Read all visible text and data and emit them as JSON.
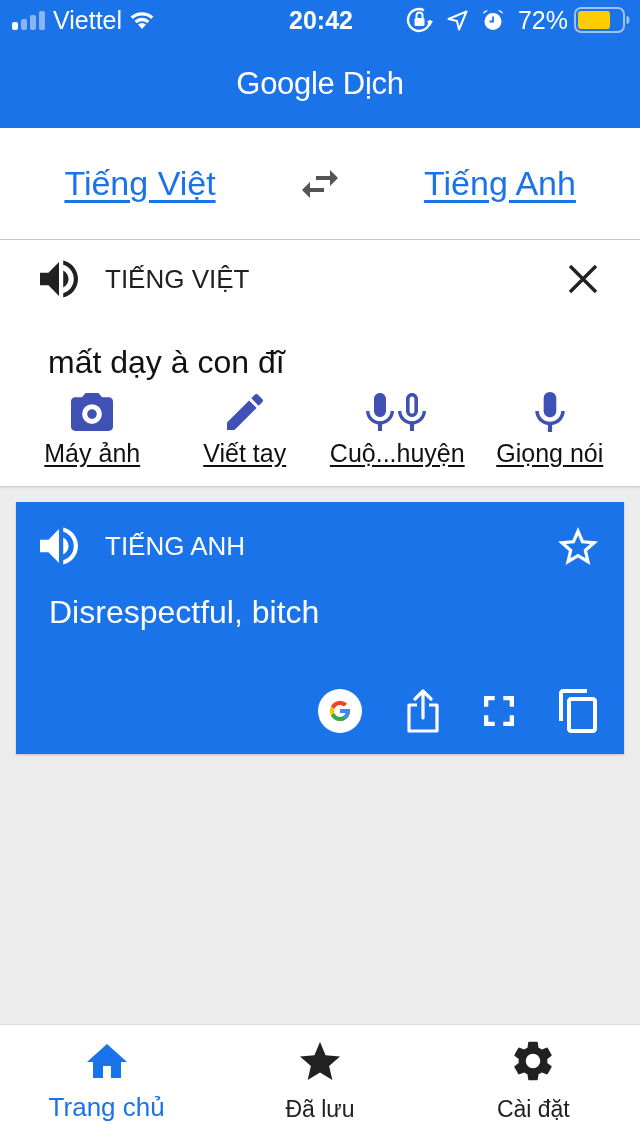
{
  "status_bar": {
    "carrier": "Viettel",
    "time": "20:42",
    "battery": "72%"
  },
  "header": {
    "title": "Google Dịch"
  },
  "language_bar": {
    "source": "Tiếng Việt",
    "target": "Tiếng Anh"
  },
  "input_card": {
    "language": "TIẾNG VIỆT",
    "text": "mất dạy à con đĩ",
    "tools": [
      {
        "label": "Máy ảnh"
      },
      {
        "label": "Viết tay"
      },
      {
        "label": "Cuộ...huyện"
      },
      {
        "label": "Giọng nói"
      }
    ]
  },
  "result_card": {
    "language": "TIẾNG ANH",
    "text": "Disrespectful, bitch",
    "starred": false
  },
  "bottom_nav": [
    {
      "label": "Trang chủ",
      "selected": true
    },
    {
      "label": "Đã lưu",
      "selected": false
    },
    {
      "label": "Cài đặt",
      "selected": false
    }
  ]
}
